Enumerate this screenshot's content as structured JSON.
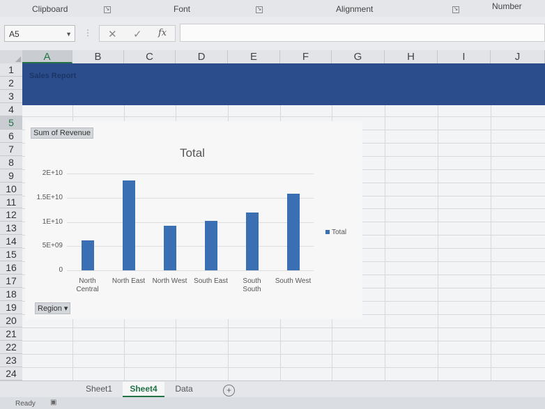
{
  "ribbon": {
    "groups": [
      {
        "label": "Clipboard"
      },
      {
        "label": "Font"
      },
      {
        "label": "Alignment"
      },
      {
        "label": "Number"
      }
    ]
  },
  "formula_bar": {
    "name_box": "A5",
    "cancel_glyph": "✕",
    "enter_glyph": "✓",
    "fx_glyph": "fx",
    "formula": ""
  },
  "grid": {
    "columns": [
      "A",
      "B",
      "C",
      "D",
      "E",
      "F",
      "G",
      "H",
      "I",
      "J"
    ],
    "rows": [
      "1",
      "2",
      "3",
      "4",
      "5",
      "6",
      "7",
      "8",
      "9",
      "10",
      "11",
      "12",
      "13",
      "14",
      "15",
      "16",
      "17",
      "18",
      "19",
      "20",
      "21",
      "22",
      "23",
      "24"
    ],
    "selected_cell": "A5",
    "banner_color": "#2b4d8c"
  },
  "report": {
    "title": "Sales Report"
  },
  "pivot": {
    "value_field": "Sum of Revenue",
    "axis_field": "Region ▾"
  },
  "chart_data": {
    "type": "bar",
    "title": "Total",
    "categories": [
      "North Central",
      "North East",
      "North West",
      "South East",
      "South South",
      "South West"
    ],
    "category_lines": [
      [
        "North",
        "Central"
      ],
      [
        "North East"
      ],
      [
        "North West"
      ],
      [
        "South East"
      ],
      [
        "South",
        "South"
      ],
      [
        "South West"
      ]
    ],
    "series": [
      {
        "name": "Total",
        "values": [
          6200000000,
          18500000000,
          9200000000,
          10200000000,
          12000000000,
          15800000000
        ],
        "color": "#3a6fb4"
      }
    ],
    "ylim": [
      0,
      20000000000
    ],
    "yticks": [
      {
        "value": 0,
        "label": "0"
      },
      {
        "value": 5000000000,
        "label": "5E+09"
      },
      {
        "value": 10000000000,
        "label": "1E+10"
      },
      {
        "value": 15000000000,
        "label": "1.5E+10"
      },
      {
        "value": 20000000000,
        "label": "2E+10"
      }
    ],
    "legend": {
      "label": "Total",
      "position": "right"
    },
    "grid": true
  },
  "sheets": {
    "tabs": [
      {
        "label": "Sheet1",
        "active": false
      },
      {
        "label": "Sheet4",
        "active": true
      },
      {
        "label": "Data",
        "active": false
      }
    ],
    "add_glyph": "+"
  },
  "status": {
    "mode": "Ready"
  },
  "colors": {
    "accent": "#217346",
    "bar": "#3a6fb4"
  }
}
